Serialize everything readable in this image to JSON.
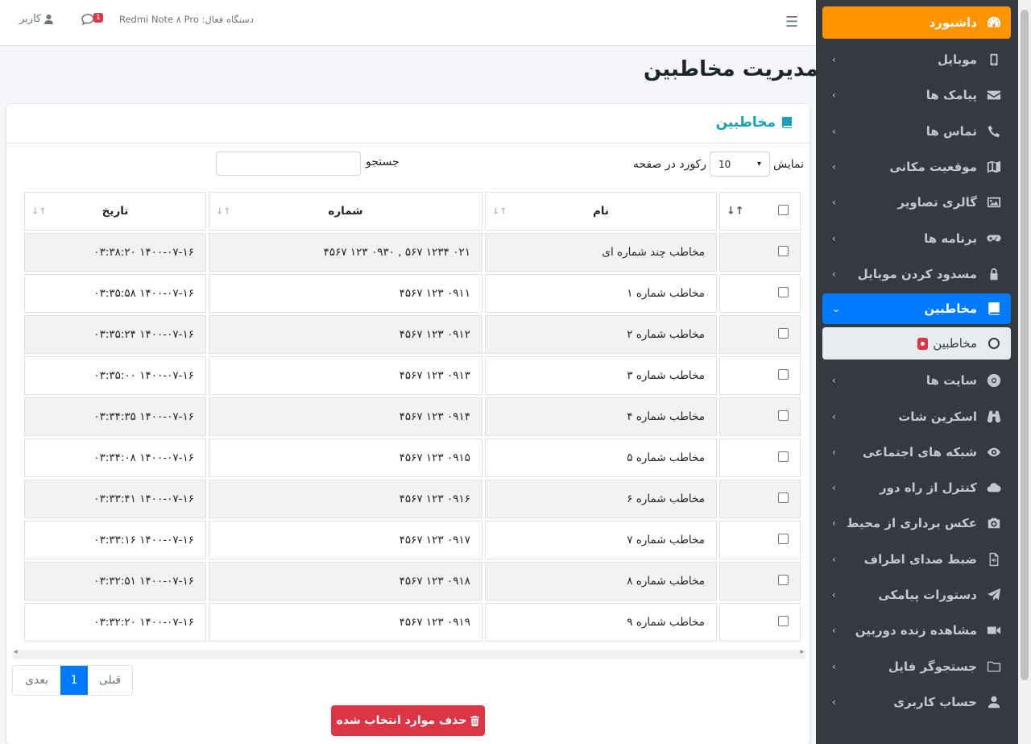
{
  "topbar": {
    "device": "دستگاه فعال: Redmi Note ۸ Pro",
    "chat_count": "1",
    "user_label": "کاربر"
  },
  "page": {
    "title": "مدیریت مخاطبین"
  },
  "card": {
    "title": "مخاطبین"
  },
  "table_controls": {
    "show_label": "نمایش",
    "per_page": "10",
    "records_label": "رکورد در صفحه",
    "search_label": "جستجو",
    "search_value": ""
  },
  "table": {
    "headers": {
      "name": "نام",
      "number": "شماره",
      "date": "تاریخ"
    },
    "rows": [
      {
        "name": "مخاطب چند شماره ای",
        "number": "۰۲۱ ۱۲۳۴ ۵۶۷ , ۰۹۳۰ ۱۲۳ ۴۵۶۷",
        "date": "۱۴۰۰-۰۷-۱۶ ۰۳:۳۸:۲۰"
      },
      {
        "name": "مخاطب شماره ۱",
        "number": "۰۹۱۱ ۱۲۳ ۴۵۶۷",
        "date": "۱۴۰۰-۰۷-۱۶ ۰۳:۳۵:۵۸"
      },
      {
        "name": "مخاطب شماره ۲",
        "number": "۰۹۱۲ ۱۲۳ ۴۵۶۷",
        "date": "۱۴۰۰-۰۷-۱۶ ۰۳:۳۵:۲۴"
      },
      {
        "name": "مخاطب شماره ۳",
        "number": "۰۹۱۳ ۱۲۳ ۴۵۶۷",
        "date": "۱۴۰۰-۰۷-۱۶ ۰۳:۳۵:۰۰"
      },
      {
        "name": "مخاطب شماره ۴",
        "number": "۰۹۱۴ ۱۲۳ ۴۵۶۷",
        "date": "۱۴۰۰-۰۷-۱۶ ۰۳:۳۴:۳۵"
      },
      {
        "name": "مخاطب شماره ۵",
        "number": "۰۹۱۵ ۱۲۳ ۴۵۶۷",
        "date": "۱۴۰۰-۰۷-۱۶ ۰۳:۳۴:۰۸"
      },
      {
        "name": "مخاطب شماره ۶",
        "number": "۰۹۱۶ ۱۲۳ ۴۵۶۷",
        "date": "۱۴۰۰-۰۷-۱۶ ۰۳:۳۳:۴۱"
      },
      {
        "name": "مخاطب شماره ۷",
        "number": "۰۹۱۷ ۱۲۳ ۴۵۶۷",
        "date": "۱۴۰۰-۰۷-۱۶ ۰۳:۳۳:۱۶"
      },
      {
        "name": "مخاطب شماره ۸",
        "number": "۰۹۱۸ ۱۲۳ ۴۵۶۷",
        "date": "۱۴۰۰-۰۷-۱۶ ۰۳:۳۲:۵۱"
      },
      {
        "name": "مخاطب شماره ۹",
        "number": "۰۹۱۹ ۱۲۳ ۴۵۶۷",
        "date": "۱۴۰۰-۰۷-۱۶ ۰۳:۳۲:۲۰"
      }
    ]
  },
  "pagination": {
    "prev": "قبلی",
    "current": "1",
    "next": "بعدی"
  },
  "actions": {
    "delete_selected": "حذف موارد انتخاب شده"
  },
  "sidebar": {
    "items": [
      {
        "label": "داشبورد",
        "icon": "dashboard-icon"
      },
      {
        "label": "موبایل",
        "icon": "mobile-icon"
      },
      {
        "label": "پیامک ها",
        "icon": "envelope-icon"
      },
      {
        "label": "تماس ها",
        "icon": "phone-icon"
      },
      {
        "label": "موقعیت مکانی",
        "icon": "map-icon"
      },
      {
        "label": "گالری تصاویر",
        "icon": "image-icon"
      },
      {
        "label": "برنامه ها",
        "icon": "gamepad-icon"
      },
      {
        "label": "مسدود کردن موبایل",
        "icon": "lock-icon"
      },
      {
        "label": "مخاطبین",
        "icon": "book-icon"
      },
      {
        "label": "مخاطبین",
        "icon": "circle-icon"
      },
      {
        "label": "سایت ها",
        "icon": "chrome-icon"
      },
      {
        "label": "اسکرین شات",
        "icon": "binoculars-icon"
      },
      {
        "label": "شبکه های اجتماعی",
        "icon": "eye-icon"
      },
      {
        "label": "کنترل از راه دور",
        "icon": "cloud-icon"
      },
      {
        "label": "عکس برداری از محیط",
        "icon": "camera-icon"
      },
      {
        "label": "ضبط صدای اطراف",
        "icon": "audio-file-icon"
      },
      {
        "label": "دستورات پیامکی",
        "icon": "paper-plane-icon"
      },
      {
        "label": "مشاهده زنده دوربین",
        "icon": "video-icon"
      },
      {
        "label": "جستجوگر فایل",
        "icon": "folder-icon"
      },
      {
        "label": "حساب کاربری",
        "icon": "user-icon"
      }
    ]
  },
  "colors": {
    "accent": "#007bff",
    "brand": "#fd9400",
    "danger": "#dc3545",
    "info": "#17a2b8",
    "sidebar_bg": "#343a40"
  }
}
